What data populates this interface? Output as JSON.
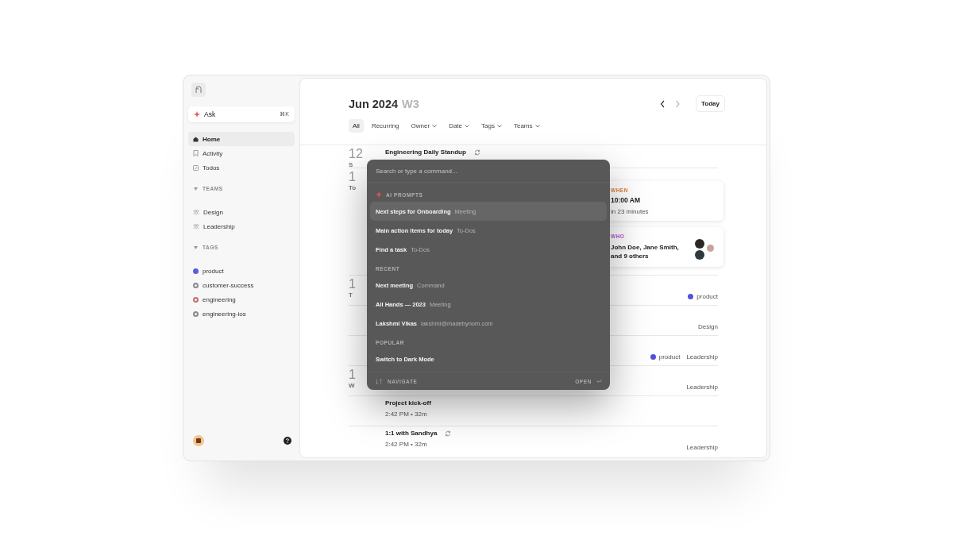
{
  "sidebar": {
    "ask": {
      "label": "Ask",
      "shortcut": "⌘K"
    },
    "nav": [
      {
        "label": "Home",
        "selected": true
      },
      {
        "label": "Activity",
        "selected": false
      },
      {
        "label": "Todos",
        "selected": false
      }
    ],
    "sections": [
      {
        "title": "TEAMS",
        "kind": "teams",
        "expanded": true,
        "items": [
          {
            "label": "Design"
          },
          {
            "label": "Leadership"
          }
        ]
      },
      {
        "title": "TAGS",
        "kind": "tags",
        "expanded": true,
        "items": [
          {
            "label": "product",
            "color": "#5b5fd6",
            "active": true
          },
          {
            "label": "customer-success",
            "color": "#8a8a8a",
            "active": false
          },
          {
            "label": "engineering",
            "color": "#c0706a",
            "active": false
          },
          {
            "label": "engineering-ios",
            "color": "#8a8a8a",
            "active": false
          }
        ]
      }
    ]
  },
  "header": {
    "month": "Jun 2024",
    "week": "W3",
    "prev": {
      "disabled": false
    },
    "next": {
      "disabled": true
    },
    "today": "Today"
  },
  "filters": [
    {
      "label": "All",
      "selected": true,
      "dropdown": false
    },
    {
      "label": "Recurring",
      "selected": false,
      "dropdown": false
    },
    {
      "label": "Owner",
      "selected": false,
      "dropdown": true
    },
    {
      "label": "Date",
      "selected": false,
      "dropdown": true
    },
    {
      "label": "Tags",
      "selected": false,
      "dropdown": true
    },
    {
      "label": "Teams",
      "selected": false,
      "dropdown": true
    }
  ],
  "rows": [
    {
      "day": {
        "number": "12",
        "weekday": "S"
      },
      "title": "Engineering Daily Standup",
      "recurring": true
    },
    {
      "day": {
        "number": "1",
        "weekday": "To"
      },
      "details": {
        "when": {
          "label": "WHEN",
          "time": "10:00 AM",
          "relative": "in 23 minutes"
        },
        "who": {
          "label": "WHO",
          "names": "John Doe, Jane Smith, and 9 others"
        }
      }
    },
    {
      "day": {
        "number": "1",
        "weekday": "T"
      },
      "tags": [
        {
          "label": "product",
          "color": "#4f54d8"
        }
      ]
    },
    {
      "team": "Design"
    },
    {
      "tags": [
        {
          "label": "product",
          "color": "#4f54d8"
        }
      ],
      "team": "Leadership"
    },
    {
      "day": {
        "number": "1",
        "weekday": "W"
      },
      "team": "Leadership"
    },
    {
      "title": "Project kick-off",
      "time": "2:42 PM • 32m"
    },
    {
      "title": "1:1 with Sandhya",
      "recurring": true,
      "time": "2:42 PM • 32m",
      "team": "Leadership"
    }
  ],
  "palette": {
    "placeholder": "Search or type a command...",
    "sections": [
      {
        "title": "AI PROMPTS",
        "items": [
          {
            "label": "Next steps for Onboarding",
            "hint": "Meeting",
            "selected": true
          },
          {
            "label": "Main action items for today",
            "hint": "To-Dos",
            "selected": false
          },
          {
            "label": "Find a task",
            "hint": "To-Dos",
            "selected": false
          }
        ]
      },
      {
        "title": "RECENT",
        "items": [
          {
            "label": "Next meeting",
            "hint": "Command",
            "selected": false
          },
          {
            "label": "All Hands — 2023",
            "hint": "Meeting",
            "selected": false
          },
          {
            "label": "Lakshmi Vikas",
            "hint": "lakshmi@madebynom.com",
            "selected": false
          }
        ]
      },
      {
        "title": "POPULAR",
        "items": [
          {
            "label": "Switch to Dark Mode",
            "selected": false
          }
        ]
      }
    ],
    "footer": {
      "navigate": "NAVIGATE",
      "open": "OPEN"
    }
  }
}
